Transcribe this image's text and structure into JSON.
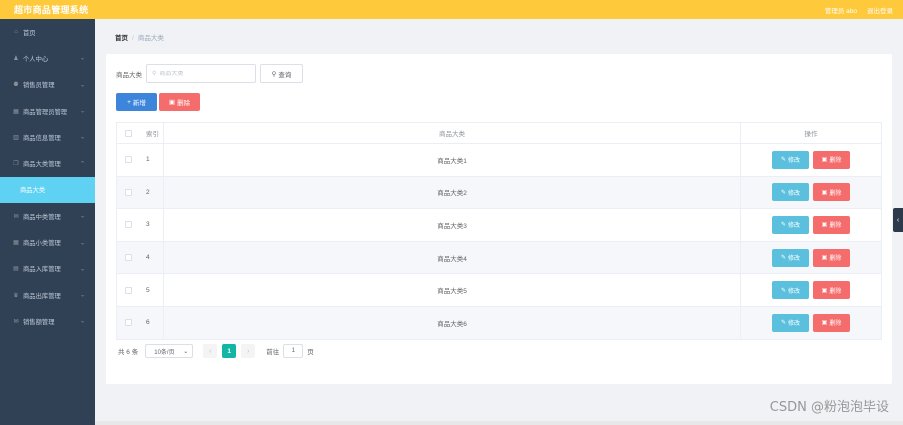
{
  "header": {
    "title": "超市商品管理系统",
    "user_label": "管理员 abo",
    "logout": "退出登录"
  },
  "sidebar": {
    "items": [
      {
        "label": "首页",
        "icon": "home-icon",
        "glyph": "⌂",
        "has_chevron": false
      },
      {
        "label": "个人中心",
        "icon": "user-icon",
        "glyph": "♟",
        "has_chevron": true
      },
      {
        "label": "销售员管理",
        "icon": "group-icon",
        "glyph": "⚉",
        "has_chevron": true
      },
      {
        "label": "商品管理员管理",
        "icon": "grid-icon",
        "glyph": "▦",
        "has_chevron": true
      },
      {
        "label": "商品信息管理",
        "icon": "chart-icon",
        "glyph": "▥",
        "has_chevron": true
      },
      {
        "label": "商品大类管理",
        "icon": "copy-icon",
        "glyph": "❐",
        "has_chevron": true,
        "expanded": true
      }
    ],
    "active_sub": "商品大类",
    "items_after": [
      {
        "label": "商品中类管理",
        "icon": "mail-icon",
        "glyph": "✉",
        "has_chevron": true
      },
      {
        "label": "商品小类管理",
        "icon": "grid-icon",
        "glyph": "▦",
        "has_chevron": true
      },
      {
        "label": "商品入库管理",
        "icon": "grid-icon",
        "glyph": "▤",
        "has_chevron": true
      },
      {
        "label": "商品出库管理",
        "icon": "trophy-icon",
        "glyph": "♛",
        "has_chevron": true
      },
      {
        "label": "销售额管理",
        "icon": "mail-icon",
        "glyph": "✉",
        "has_chevron": true
      }
    ]
  },
  "breadcrumb": {
    "home": "首页",
    "separator": "/",
    "current": "商品大类"
  },
  "search": {
    "label": "商品大类",
    "placeholder": "商品大类",
    "value": "",
    "query_button": "查询"
  },
  "actions": {
    "add": "新增",
    "delete": "删除"
  },
  "table": {
    "headers": {
      "index": "索引",
      "name": "商品大类",
      "ops": "操作"
    },
    "rows": [
      {
        "index": "1",
        "name": "商品大类1"
      },
      {
        "index": "2",
        "name": "商品大类2"
      },
      {
        "index": "3",
        "name": "商品大类3"
      },
      {
        "index": "4",
        "name": "商品大类4"
      },
      {
        "index": "5",
        "name": "商品大类5"
      },
      {
        "index": "6",
        "name": "商品大类6"
      }
    ],
    "edit_label": "修改",
    "delete_label": "删除"
  },
  "pagination": {
    "total": "共 6 条",
    "page_size": "10条/页",
    "current_page": "1",
    "goto_label": "前往",
    "goto_value": "1",
    "page_suffix": "页"
  },
  "watermark": "CSDN @粉泡泡毕设",
  "colors": {
    "header": "#ffc93c",
    "sidebar": "#304156",
    "active_sub": "#5fd1f3",
    "primary": "#3d84db",
    "danger": "#f56c6c",
    "edit": "#5bc0de",
    "page_active": "#13b5a5"
  }
}
